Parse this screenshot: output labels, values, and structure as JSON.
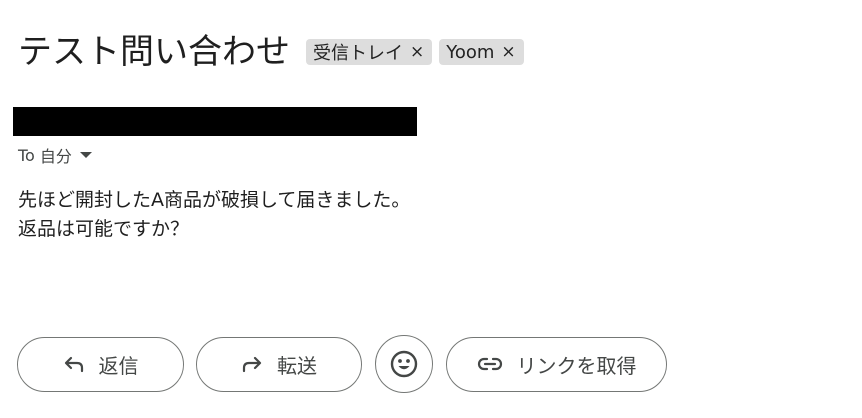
{
  "email": {
    "subject": "テスト問い合わせ",
    "labels": [
      {
        "name": "受信トレイ",
        "remove": "×"
      },
      {
        "name": "Yoom",
        "remove": "×"
      }
    ],
    "recipient": {
      "to_label": "To",
      "value": "自分"
    },
    "body_lines": [
      "先ほど開封したA商品が破損して届きました。",
      "返品は可能ですか？"
    ]
  },
  "actions": {
    "reply_label": "返信",
    "forward_label": "転送",
    "link_label": "リンクを取得"
  },
  "icons": {
    "reply": "reply-arrow-icon",
    "forward": "forward-arrow-icon",
    "emoji": "emoji-smile-icon",
    "link": "link-icon",
    "dropdown": "chevron-down-icon"
  },
  "colors": {
    "label_chip_bg": "#dddddd",
    "button_border": "#747775",
    "secondary_text": "#444746",
    "redaction": "#000000"
  }
}
